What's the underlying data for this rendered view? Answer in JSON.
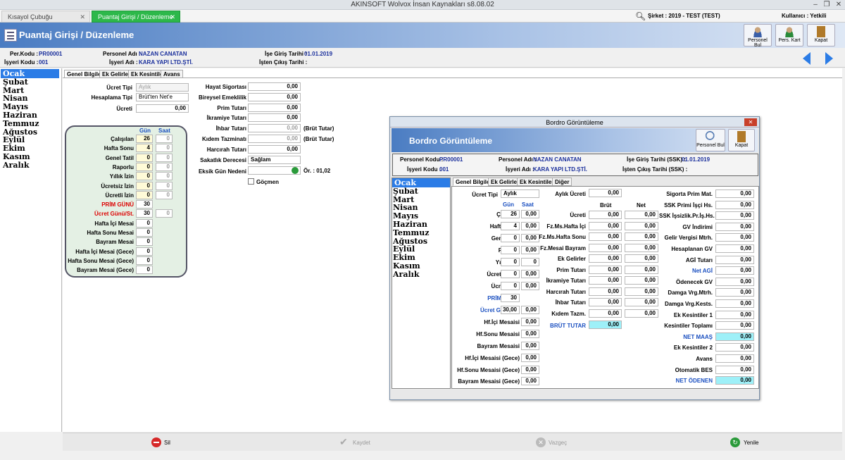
{
  "window": {
    "title": "AKINSOFT Wolvox İnsan Kaynakları s8.08.02"
  },
  "tabs": [
    {
      "label": "Kısayol Çubuğu"
    },
    {
      "label": "Puantaj Girişi / Düzenleme"
    }
  ],
  "topbar": {
    "sirket": "Şirket : 2019 - TEST (TEST)",
    "kullanici": "Kullanıcı : Yetkili"
  },
  "header": {
    "title": "Puantaj Girişi / Düzenleme",
    "buttons": [
      "Personel Bul",
      "Pers. Kart",
      "Kapat"
    ]
  },
  "info": {
    "per_kodu_l": "Per.Kodu :",
    "per_kodu": "PR00001",
    "isyeri_l": "İşyeri Kodu :",
    "isyeri": "001",
    "ad_l": "Personel Adı :",
    "ad": "NAZAN CANATAN",
    "isyeri_ad_l": "İşyeri Adı :",
    "isyeri_ad": "KARA YAPI LTD.ŞTİ.",
    "giris_l": "İşe Giriş Tarihi :",
    "giris": "01.01.2019",
    "cikis_l": "İşten Çıkış Tarihi :"
  },
  "months": [
    "Ocak",
    "Şubat",
    "Mart",
    "Nisan",
    "Mayıs",
    "Haziran",
    "Temmuz",
    "Ağustos",
    "Eylül",
    "Ekim",
    "Kasım",
    "Aralık"
  ],
  "subtabs": [
    "Genel Bilgiler",
    "Ek Gelirler",
    "Ek Kesintiler",
    "Avans"
  ],
  "form": {
    "ucret_tipi_l": "Ücret Tipi",
    "ucret_tipi": "Aylık",
    "hesap_l": "Hesaplama Tipi",
    "hesap": "Brüt'ten Net'e",
    "ucreti_l": "Ücreti",
    "ucreti": "0,00",
    "gun_h": "Gün",
    "saat_h": "Saat",
    "rows": [
      {
        "l": "Çalışılan",
        "g": "26",
        "s": "0"
      },
      {
        "l": "Hafta Sonu",
        "g": "4",
        "s": "0"
      },
      {
        "l": "Genel Tatil",
        "g": "0",
        "s": "0"
      },
      {
        "l": "Raporlu",
        "g": "0",
        "s": "0"
      },
      {
        "l": "Yıllık İzin",
        "g": "0",
        "s": "0"
      },
      {
        "l": "Ücretsiz İzin",
        "g": "0",
        "s": "0"
      },
      {
        "l": "Ücretli İzin",
        "g": "0",
        "s": "0"
      },
      {
        "l": "PRİM GÜNÜ",
        "g": "30",
        "s": ""
      },
      {
        "l": "Ücret Günü/St.",
        "g": "30",
        "s": "0"
      },
      {
        "l": "Hafta İçi Mesai",
        "g": "0",
        "s": ""
      },
      {
        "l": "Hafta Sonu Mesai",
        "g": "0",
        "s": ""
      },
      {
        "l": "Bayram Mesai",
        "g": "0",
        "s": ""
      },
      {
        "l": "Hafta İçi Mesai (Gece)",
        "g": "0",
        "s": ""
      },
      {
        "l": "Hafta Sonu Mesai (Gece)",
        "g": "0",
        "s": ""
      },
      {
        "l": "Bayram Mesai (Gece)",
        "g": "0",
        "s": ""
      }
    ],
    "mid": [
      {
        "l": "Hayat Sigortası",
        "v": "0,00"
      },
      {
        "l": "Bireysel Emeklilik",
        "v": "0,00"
      },
      {
        "l": "Prim Tutarı",
        "v": "0,00"
      },
      {
        "l": "İkramiye Tutarı",
        "v": "0,00"
      },
      {
        "l": "İhbar Tutarı",
        "v": "0,00",
        "n": "(Brüt Tutar)"
      },
      {
        "l": "Kıdem Tazminatı",
        "v": "0,00",
        "n": "(Brüt Tutar)"
      },
      {
        "l": "Harcırah Tutarı",
        "v": "0,00"
      }
    ],
    "sakatlik_l": "Sakatlık Derecesi",
    "sakatlik": "Sağlam",
    "eksik_l": "Eksik Gün Nedeni",
    "or": "Ör. : 01,02",
    "gocmen": "Göçmen"
  },
  "bottom": [
    "Sil",
    "Kaydet",
    "Vazgeç",
    "Yenile"
  ],
  "dialog": {
    "title": "Bordro Görüntüleme",
    "header": "Bordro Görüntüleme",
    "buttons": [
      "Personel Bul",
      "Kapat"
    ],
    "info": {
      "pk_l": "Personel Kodu :",
      "pk": "PR00001",
      "ik_l": "İşyeri Kodu :",
      "ik": "001",
      "pa_l": "Personel Adı :",
      "pa": "NAZAN CANATAN",
      "ia_l": "İşyeri Adı :",
      "ia": "KARA YAPI LTD.ŞTİ.",
      "gt_l": "İşe Giriş Tarihi (SSK) :",
      "gt": "01.01.2019",
      "ct_l": "İşten Çıkış Tarihi (SSK) :"
    },
    "subtabs": [
      "Genel Bilgiler",
      "Ek Gelirler",
      "Ek Kesintiler",
      "Diğer"
    ],
    "ucret_tipi_l": "Ücret Tipi",
    "ucret_tipi": "Aylık",
    "gun_h": "Gün",
    "saat_h": "Saat",
    "left": [
      {
        "l": "Çalışılan",
        "g": "26",
        "s": "0,00"
      },
      {
        "l": "Hafta Sonu",
        "g": "4",
        "s": "0,00"
      },
      {
        "l": "Genel Tatil",
        "g": "0",
        "s": "0,00"
      },
      {
        "l": "Raporlu",
        "g": "0",
        "s": "0,00"
      },
      {
        "l": "Yıllık İzin",
        "g": "0",
        "s": "0"
      },
      {
        "l": "Ücretsiz İzin",
        "g": "0",
        "s": "0,00"
      },
      {
        "l": "Ücretli İzin",
        "g": "0",
        "s": "0,00"
      },
      {
        "l": "PRİM GÜNÜ",
        "g": "30",
        "s": ""
      },
      {
        "l": "Ücret Günü/St.",
        "g": "30,00",
        "s": "0,00"
      },
      {
        "l": "Hf.İçi Mesaisi",
        "g": "",
        "s": "0,00"
      },
      {
        "l": "Hf.Sonu Mesaisi",
        "g": "",
        "s": "0,00"
      },
      {
        "l": "Bayram Mesaisi",
        "g": "",
        "s": "0,00"
      },
      {
        "l": "Hf.İçi Mesaisi (Gece)",
        "g": "",
        "s": "0,00"
      },
      {
        "l": "Hf.Sonu Mesaisi (Gece)",
        "g": "",
        "s": "0,00"
      },
      {
        "l": "Bayram Mesaisi (Gece)",
        "g": "",
        "s": "0,00"
      }
    ],
    "aylik_l": "Aylık Ücreti",
    "aylik": "0,00",
    "brut_h": "Brüt",
    "net_h": "Net",
    "center": [
      {
        "l": "Ücreti",
        "b": "0,00",
        "n": "0,00"
      },
      {
        "l": "Fz.Ms.Hafta İçi",
        "b": "0,00",
        "n": "0,00"
      },
      {
        "l": "Fz.Ms.Hafta Sonu",
        "b": "0,00",
        "n": "0,00"
      },
      {
        "l": "Fz.Mesai Bayram",
        "b": "0,00",
        "n": "0,00"
      },
      {
        "l": "Ek Gelirler",
        "b": "0,00",
        "n": "0,00"
      },
      {
        "l": "Prim Tutarı",
        "b": "0,00",
        "n": "0,00"
      },
      {
        "l": "İkramiye Tutarı",
        "b": "0,00",
        "n": "0,00"
      },
      {
        "l": "Harcırah Tutarı",
        "b": "0,00",
        "n": "0,00"
      },
      {
        "l": "İhbar Tutarı",
        "b": "0,00",
        "n": "0,00"
      },
      {
        "l": "Kıdem Tazm.",
        "b": "0,00",
        "n": "0,00"
      }
    ],
    "brut_tutar_l": "BRÜT TUTAR",
    "brut_tutar": "0,00",
    "right": [
      {
        "l": "Sigorta Prim Mat.",
        "v": "0,00"
      },
      {
        "l": "SSK Primi İşçi Hs.",
        "v": "0,00"
      },
      {
        "l": "SSK İşsizlik.Pr.İş.Hs.",
        "v": "0,00"
      },
      {
        "l": "GV İndirimi",
        "v": "0,00"
      },
      {
        "l": "Gelir Vergisi Mtrh.",
        "v": "0,00"
      },
      {
        "l": "Hesaplanan GV",
        "v": "0,00"
      },
      {
        "l": "AGİ Tutarı",
        "v": "0,00"
      },
      {
        "l": "Net AGİ",
        "v": "0,00"
      },
      {
        "l": "Ödenecek GV",
        "v": "0,00"
      },
      {
        "l": "Damga Vrg.Mtrh.",
        "v": "0,00"
      },
      {
        "l": "Damga Vrg.Kests.",
        "v": "0,00"
      },
      {
        "l": "Ek Kesintiler 1",
        "v": "0,00"
      },
      {
        "l": "Kesintiler Toplamı",
        "v": "0,00"
      },
      {
        "l": "NET MAAŞ",
        "v": "0,00"
      },
      {
        "l": "Ek Kesintiler 2",
        "v": "0,00"
      },
      {
        "l": "Avans",
        "v": "0,00"
      },
      {
        "l": "Otomatik BES",
        "v": "0,00"
      },
      {
        "l": "NET ÖDENEN",
        "v": "0,00"
      }
    ]
  }
}
